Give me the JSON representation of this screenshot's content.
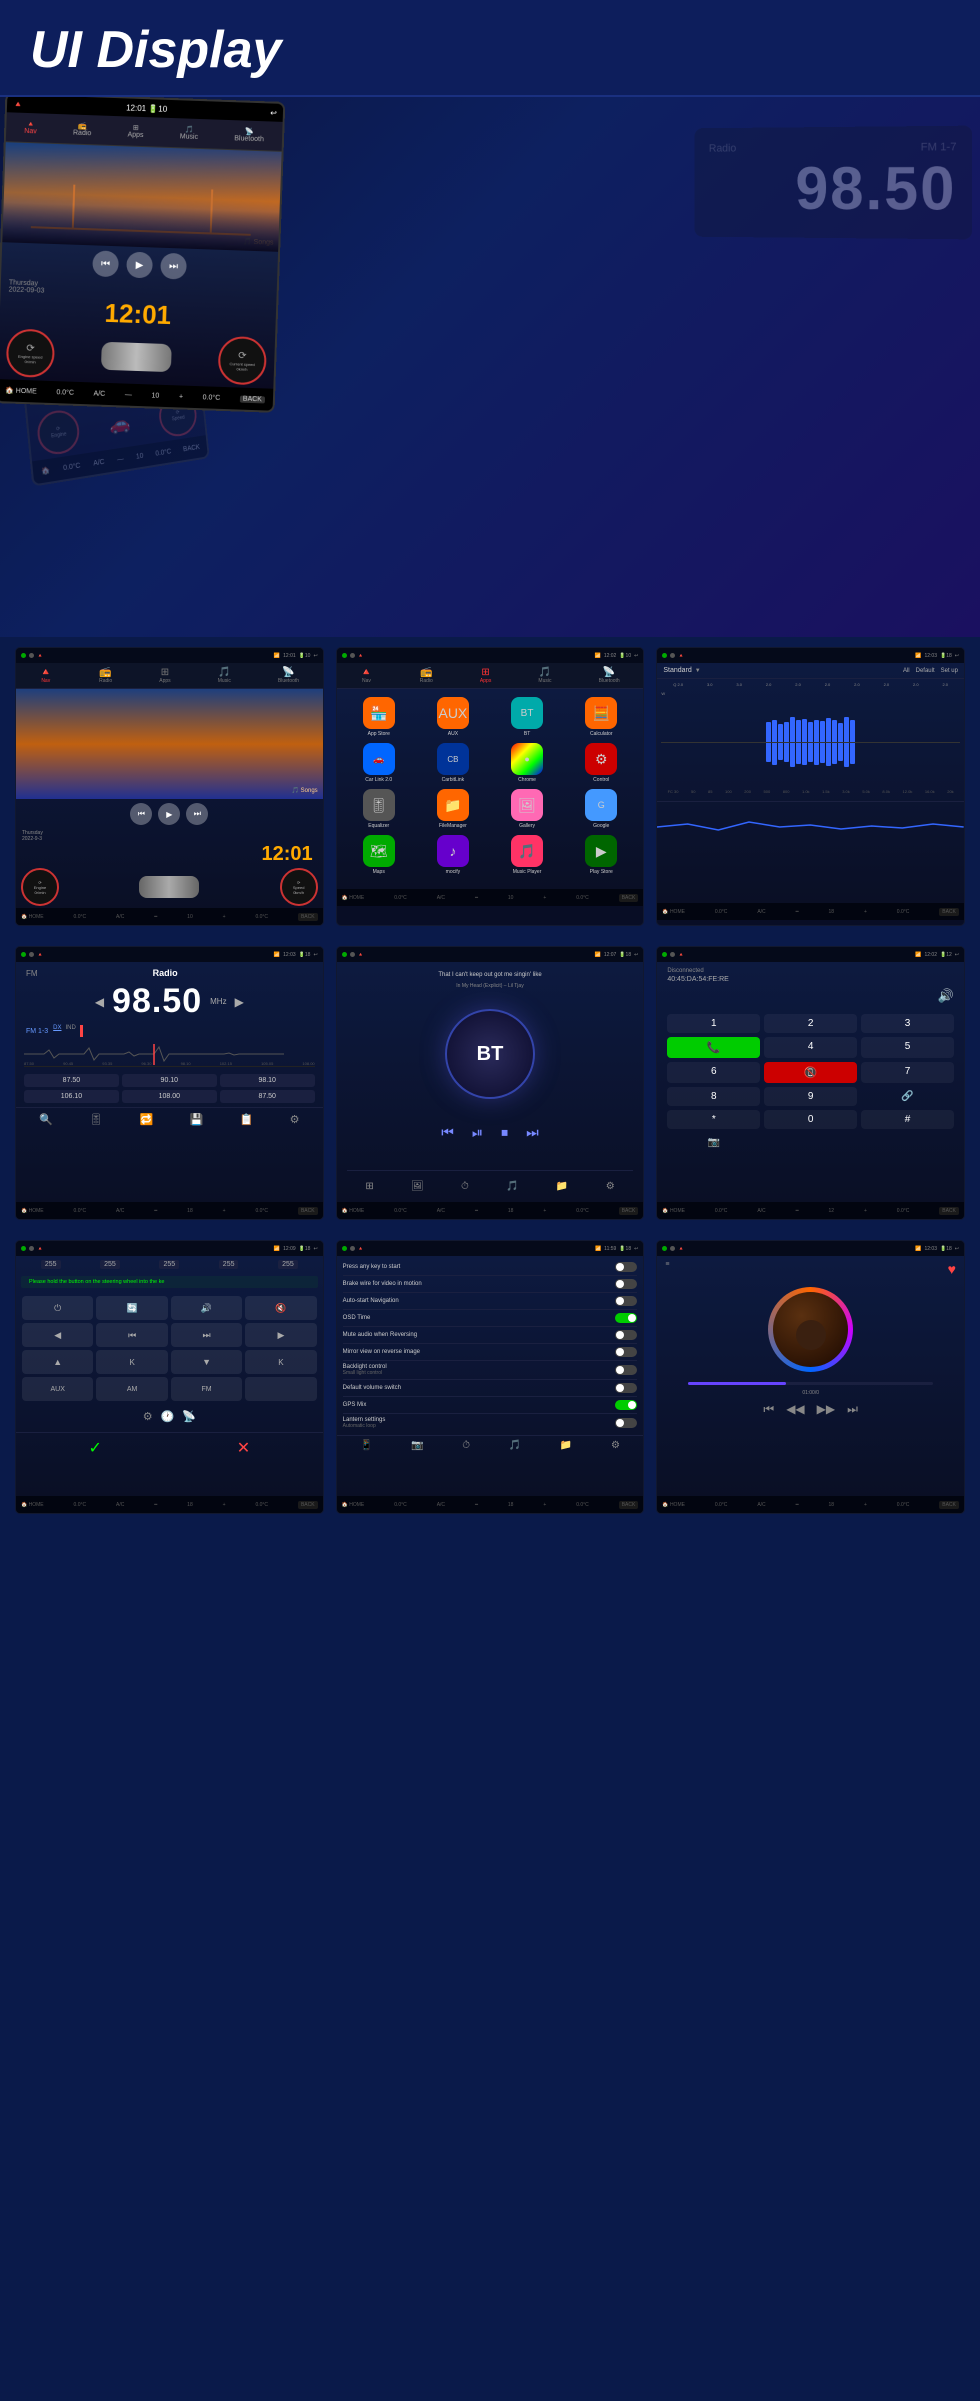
{
  "header": {
    "title": "UI Display"
  },
  "hero": {
    "center_screen": {
      "time": "12:01",
      "date": "Thursday 2022-09-03"
    }
  },
  "panels": {
    "row1": [
      {
        "id": "home",
        "status": "12:01 🔋10",
        "nav_items": [
          "Nav",
          "Radio",
          "Apps",
          "Music",
          "Bluetooth"
        ],
        "time": "12:01",
        "date": "2022-9-3",
        "bottom": "HOME 0.0°C A/C — 10 0.0°C BACK"
      },
      {
        "id": "apps",
        "status": "12:02 🔋10",
        "nav_items": [
          "Nav",
          "Radio",
          "Apps",
          "Music",
          "Bluetooth"
        ],
        "apps": [
          {
            "label": "App Store",
            "color": "orange"
          },
          {
            "label": "AUX",
            "color": "orange"
          },
          {
            "label": "BT",
            "color": "teal"
          },
          {
            "label": "Calculator",
            "color": "orange"
          },
          {
            "label": "Car Link 2.0",
            "color": "blue"
          },
          {
            "label": "CarbitLink",
            "color": "darkblue"
          },
          {
            "label": "Chrome",
            "color": "chrome"
          },
          {
            "label": "Control",
            "color": "red"
          },
          {
            "label": "Equalizer",
            "color": "gray"
          },
          {
            "label": "FileManager",
            "color": "orange"
          },
          {
            "label": "Gallery",
            "color": "pink"
          },
          {
            "label": "Google",
            "color": "lightblue"
          },
          {
            "label": "Maps",
            "color": "green"
          },
          {
            "label": "mocify",
            "color": "purple"
          },
          {
            "label": "Music Player",
            "color": "rose"
          },
          {
            "label": "Play Store",
            "color": "dkgreen"
          }
        ],
        "bottom": "HOME 0.0°C A/C — 10 0.0°C BACK"
      },
      {
        "id": "eq",
        "status": "12:03 🔋18",
        "label": "Standard",
        "bottom_label": "All Default Set up",
        "eq_values": [
          5,
          6,
          5,
          4,
          5,
          6,
          7,
          5,
          4,
          6,
          5,
          7,
          6,
          5,
          4,
          6,
          5,
          6,
          7,
          5
        ],
        "freq_labels": [
          "FC 30",
          "50",
          "85",
          "100",
          "200",
          "500",
          "800",
          "1.0k",
          "1.5k",
          "2.0k",
          "3.0k",
          "5.0k",
          "8.0k",
          "12.0k",
          "16.0k",
          "20k"
        ],
        "bottom": "HOME 0.0°C A/C — 18 0.0°C BACK"
      }
    ],
    "row2": [
      {
        "id": "radio",
        "status": "12:03 🔋18",
        "label_fm": "FM",
        "label_radio": "Radio",
        "freq": "98.50",
        "freq_unit": "MHz",
        "band": "FM 1-3",
        "band_mode": [
          "DX",
          "IND"
        ],
        "freq_range": "87.50 90.45 93.35 96.30 98.10 102.15 105.05 108.00",
        "presets": [
          "87.50",
          "90.10",
          "98.10",
          "106.10",
          "108.00",
          "87.50"
        ],
        "bottom": "HOME 0.0°C A/C — 18 0.0°C BACK"
      },
      {
        "id": "bt",
        "status": "12:07 🔋18",
        "song_title": "That I can't keep out got me singin' like",
        "song_sub": "In My Head (Explicit) – Lil Tjay",
        "bt_label": "BT",
        "controls": [
          "⏮",
          "⏯",
          "⏹",
          "⏭"
        ],
        "bottom": "HOME 0.0°C A/C — 18 0.0°C BACK"
      },
      {
        "id": "phone",
        "status": "12:02 🔋12",
        "disconnected": "Disconnected",
        "address": "40:45:DA:54:FE:RE",
        "keys": [
          "1",
          "2",
          "3",
          "☎",
          "4",
          "5",
          "6",
          "📵",
          "7",
          "8",
          "9",
          "🔗",
          "*",
          "0",
          "#",
          "📷"
        ],
        "bottom": "HOME 0.0°C A/C — 12 0.0°C BACK"
      }
    ],
    "row3": [
      {
        "id": "steering",
        "status": "12:09 🔋18",
        "notice": "Please hold the button on the steering wheel into the ke",
        "values": [
          "255",
          "255",
          "255",
          "255",
          "255"
        ],
        "buttons": [
          "⏻",
          "🔄",
          "🔊",
          "🔇",
          "◀",
          "⏮",
          "⏭",
          "▶",
          "▲",
          "K",
          "▼",
          "K",
          "AUX",
          "AM",
          "FM"
        ],
        "bottom": "HOME 0.0°C A/C — 18 0.0°C BACK"
      },
      {
        "id": "settings",
        "status": "11:59 🔋18",
        "items": [
          {
            "label": "Press any key to start",
            "toggle": "off"
          },
          {
            "label": "Brake wire for video in motion",
            "toggle": "off"
          },
          {
            "label": "Auto-start Navigation",
            "toggle": "off"
          },
          {
            "label": "OSD Time",
            "toggle": "on"
          },
          {
            "label": "Mute audio when Reversing",
            "toggle": "off"
          },
          {
            "label": "Mirror view on reverse image",
            "toggle": "off"
          },
          {
            "label": "Backlight control",
            "sub": "Small light control",
            "toggle": "off"
          },
          {
            "label": "Default volume switch",
            "toggle": "off"
          },
          {
            "label": "GPS Mix",
            "toggle": "on"
          },
          {
            "label": "Lantern settings",
            "sub": "Automatic loop",
            "toggle": "off"
          }
        ],
        "bottom_icons": [
          "📱",
          "📷",
          "⏰",
          "🎵",
          "📁",
          "⚙"
        ],
        "bottom": "HOME 0.0°C A/C — 18 0.0°C BACK"
      },
      {
        "id": "music",
        "status": "12:03 🔋18",
        "time_display": "01:00/0",
        "controls": [
          "⏮",
          "◀◀",
          "▶▶",
          "⏭"
        ],
        "bottom": "HOME 0.0°C A/C — 18 0.0°C BACK"
      }
    ]
  },
  "labels": {
    "back": "BACK",
    "home": "HOME",
    "ac": "A/C",
    "temp": "0.0°C",
    "nav": "Nav",
    "radio": "Radio",
    "apps": "Apps",
    "music": "Music",
    "bluetooth": "Bluetooth"
  }
}
